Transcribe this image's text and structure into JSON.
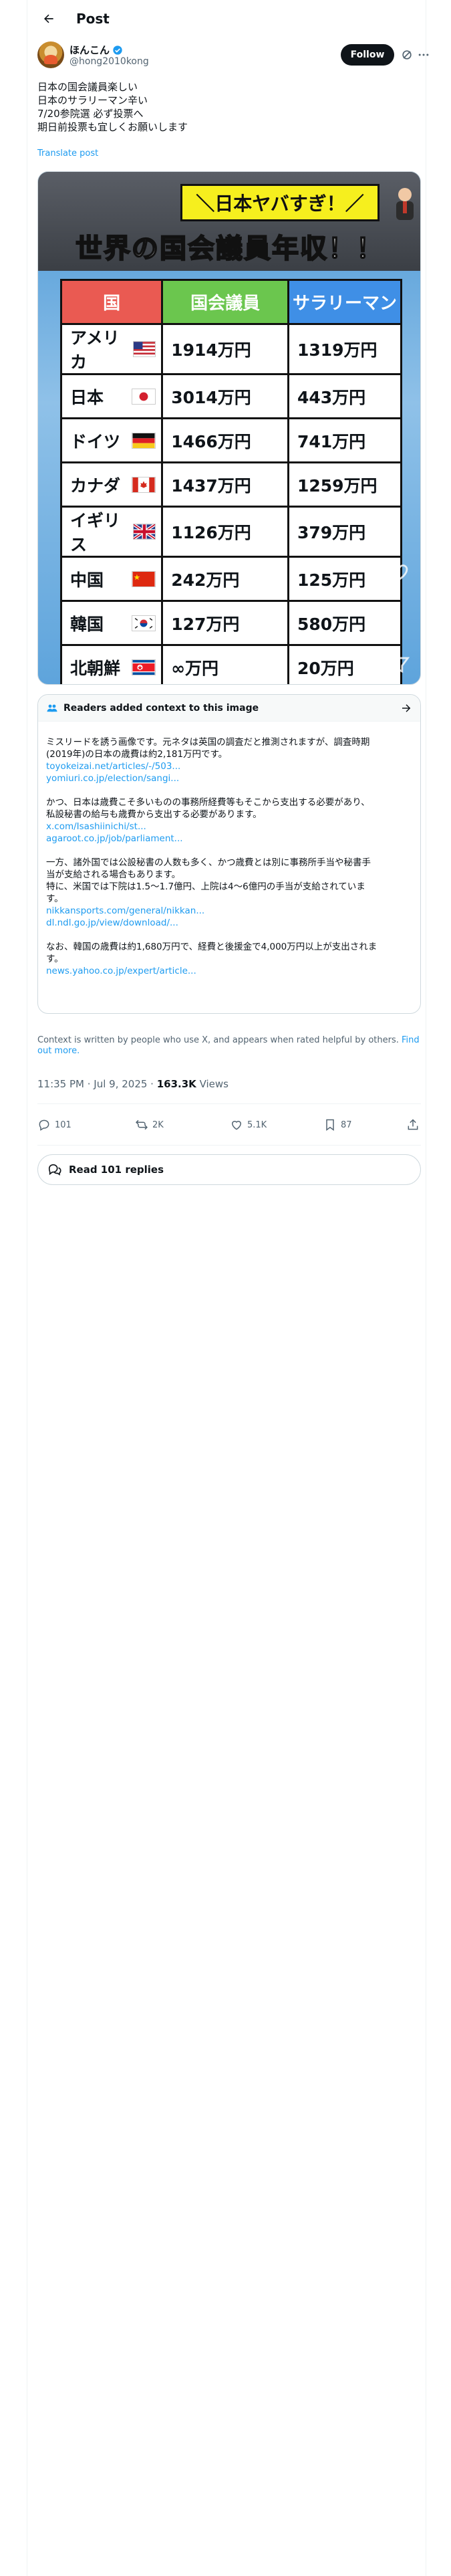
{
  "header": {
    "title": "Post"
  },
  "author": {
    "name": "ほんこん",
    "handle": "@hong2010kong",
    "follow_label": "Follow"
  },
  "post": {
    "lines": [
      "日本の国会議員楽しい",
      "日本のサラリーマン辛い",
      "7/20参院選 必ず投票へ",
      "期日前投票も宜しくお願いします"
    ],
    "translate_label": "Translate post"
  },
  "image": {
    "banner": "＼日本ヤバすぎ！／",
    "title": "世界の国会議員年収！！",
    "columns": [
      "国",
      "国会議員",
      "サラリーマン"
    ],
    "rows": [
      {
        "country": "アメリカ",
        "flag": "us-flag-icon",
        "mp": "1914万円",
        "worker": "1319万円"
      },
      {
        "country": "日本",
        "flag": "jp-flag-icon",
        "mp": "3014万円",
        "worker": "443万円"
      },
      {
        "country": "ドイツ",
        "flag": "de-flag-icon",
        "mp": "1466万円",
        "worker": "741万円"
      },
      {
        "country": "カナダ",
        "flag": "ca-flag-icon",
        "mp": "1437万円",
        "worker": "1259万円"
      },
      {
        "country": "イギリス",
        "flag": "uk-flag-icon",
        "mp": "1126万円",
        "worker": "379万円"
      },
      {
        "country": "中国",
        "flag": "cn-flag-icon",
        "mp": "242万円",
        "worker": "125万円"
      },
      {
        "country": "韓国",
        "flag": "kr-flag-icon",
        "mp": "127万円",
        "worker": "580万円"
      },
      {
        "country": "北朝鮮",
        "flag": "kp-flag-icon",
        "mp": "∞万円",
        "worker": "20万円"
      }
    ]
  },
  "community_note": {
    "title": "Readers added context to this image",
    "paragraphs": [
      {
        "lines": [
          "ミスリードを誘う画像です。元ネタは英国の調査だと推測されますが、調査時期",
          "(2019年)の日本の歳費は約2,181万円です。"
        ],
        "links": [
          "toyokeizai.net/articles/-/503...",
          "yomiuri.co.jp/election/sangi..."
        ]
      },
      {
        "lines": [
          "かつ、日本は歳費こそ多いものの事務所経費等もそこから支出する必要があり、",
          "私設秘書の給与も歳費から支出する必要があります。"
        ],
        "links": [
          "x.com/Isashiinichi/st...",
          "agaroot.co.jp/job/parliament..."
        ]
      },
      {
        "lines": [
          "一方、諸外国では公設秘書の人数も多く、かつ歳費とは別に事務所手当や秘書手",
          "当が支給される場合もあります。",
          "特に、米国では下院は1.5〜1.7億円、上院は4〜6億円の手当が支給されていま",
          "す。"
        ],
        "links": [
          "nikkansports.com/general/nikkan...",
          "dl.ndl.go.jp/view/download/..."
        ]
      },
      {
        "lines": [
          "なお、韓国の歳費は約1,680万円で、経費と後援金で4,000万円以上が支出されま",
          "す。"
        ],
        "links": [
          "news.yahoo.co.jp/expert/article..."
        ]
      }
    ]
  },
  "disclaimer": {
    "text": "Context is written by people who use X, and appears when rated helpful by others.",
    "link": "Find out more."
  },
  "meta": {
    "time": "11:35 PM · Jul 9, 2025 · ",
    "views": "163.3K",
    "views_label": " Views"
  },
  "actions": {
    "replies": "101",
    "reposts": "2K",
    "likes": "5.1K",
    "bookmarks": "87"
  },
  "read_replies": "Read 101 replies",
  "colors": {
    "accent": "#1d9bf0",
    "text": "#0f1419",
    "muted": "#536471"
  }
}
